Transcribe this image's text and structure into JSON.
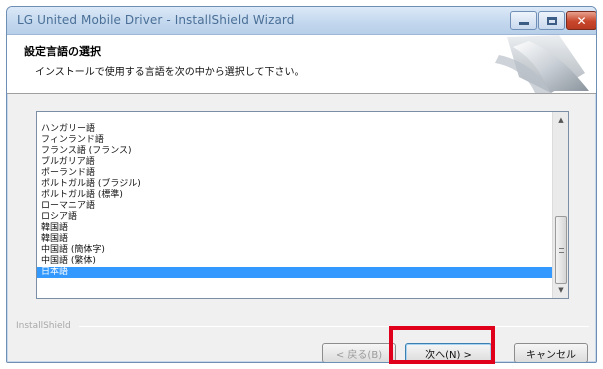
{
  "window": {
    "title": "LG United Mobile Driver - InstallShield Wizard"
  },
  "header": {
    "title": "設定言語の選択",
    "description": "インストールで使用する言語を次の中から選択して下さい。"
  },
  "language_list": {
    "items": [
      "ハンガリー語",
      "フィンランド語",
      "フランス語 (フランス)",
      "ブルガリア語",
      "ポーランド語",
      "ポルトガル語 (ブラジル)",
      "ポルトガル語 (標準)",
      "ローマニア語",
      "ロシア語",
      "韓国語",
      "韓国語",
      "中国語 (簡体字)",
      "中国語 (繁体)",
      "日本語"
    ],
    "selected_index": 13
  },
  "footer": {
    "brand_label": "InstallShield",
    "back_label": "< 戻る(B)",
    "next_label": "次へ(N) >",
    "cancel_label": "キャンセル"
  },
  "colors": {
    "selection": "#3399ff",
    "highlight": "#e0001b"
  },
  "icons": {
    "minimize": "minimize-icon",
    "maximize": "maximize-icon",
    "close": "close-icon",
    "scroll_up": "arrow-up-icon",
    "scroll_down": "arrow-down-icon"
  }
}
